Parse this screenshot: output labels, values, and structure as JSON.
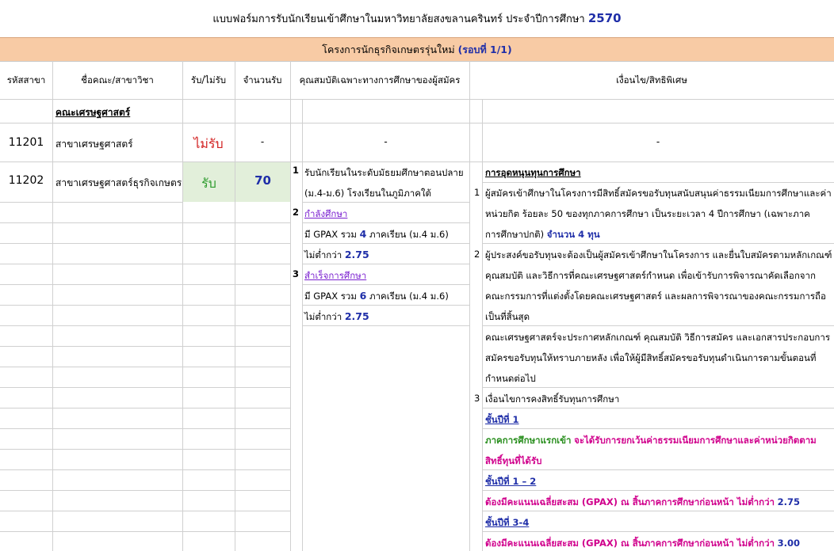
{
  "form_title": "แบบฟอร์มการรับนักเรียนเข้าศึกษาในมหาวิทยาลัยสงขลานครินทร์ ประจำปีการศึกษา",
  "year": "2570",
  "project_name": "โครงการนักธุรกิจเกษตรรุ่นใหม่",
  "round_label": "(รอบที่ 1/1)",
  "headers": {
    "code": "รหัสสาขา",
    "faculty": "ชื่อคณะ/สาขาวิชา",
    "accept": "รับ/ไม่รับ",
    "count": "จำนวนรับ",
    "qualifications": "คุณสมบัติเฉพาะทางการศึกษาของผู้สมัคร",
    "conditions": "เงื่อนไข/สิทธิพิเศษ"
  },
  "faculty_name": "คณะเศรษฐศาสตร์",
  "rows": [
    {
      "code": "11201",
      "major": "สาขาเศรษฐศาสตร์",
      "status": "ไม่รับ",
      "count": "-",
      "qual": "-",
      "cond": "-"
    },
    {
      "code": "11202",
      "major": "สาขาเศรษฐศาสตร์ธุรกิจเกษตร",
      "status": "รับ",
      "count": "70"
    }
  ],
  "qualifications": {
    "n1": "1",
    "q1_line1": "รับนักเรียนในระดับมัธยมศึกษาตอนปลาย",
    "q1_line2": "(ม.4-ม.6) โรงเรียนในภูมิภาคใต้",
    "n2": "2",
    "q2_title": "กำลังศึกษา",
    "q2_line1_pre": "มี GPAX รวม",
    "q2_line1_num": "4",
    "q2_line1_post": "ภาคเรียน (ม.4 ม.6)",
    "q2_line2_pre": "ไม่ต่ำกว่า",
    "q2_line2_num": "2.75",
    "n3": "3",
    "q3_title": "สำเร็จการศึกษา",
    "q3_line1_pre": "มี GPAX รวม",
    "q3_line1_num": "6",
    "q3_line1_post": "ภาคเรียน (ม.4 ม.6)",
    "q3_line2_pre": "ไม่ต่ำกว่า",
    "q3_line2_num": "2.75"
  },
  "conditions": {
    "heading": "การอุดหนุนทุนการศึกษา",
    "n1": "1",
    "c1_line1": "ผู้สมัครเข้าศึกษาในโครงการมีสิทธิ์สมัครขอรับทุนสนับสนุนค่าธรรมเนียมการศึกษาและค่า",
    "c1_line2": "หน่วยกิต ร้อยละ 50 ของทุกภาคการศึกษา เป็นระยะเวลา 4 ปีการศึกษา (เฉพาะภาค",
    "c1_line3_pre": "การศึกษาปกติ)",
    "c1_line3_bold": "จำนวน 4 ทุน",
    "n2": "2",
    "c2_line1": "ผู้ประสงค์ขอรับทุนจะต้องเป็นผู้สมัครเข้าศึกษาในโครงการ และยื่นใบสมัครตามหลักเกณฑ์",
    "c2_line2": "คุณสมบัติ และวิธีการที่คณะเศรษฐศาสตร์กำหนด เพื่อเข้ารับการพิจารณาคัดเลือกจาก",
    "c2_line3": "คณะกรรมการที่แต่งตั้งโดยคณะเศรษฐศาสตร์ และผลการพิจารณาของคณะกรรมการถือ",
    "c2_line4": "เป็นที่สิ้นสุด",
    "c2_line5": "คณะเศรษฐศาสตร์จะประกาศหลักเกณฑ์ คุณสมบัติ วิธีการสมัคร และเอกสารประกอบการ",
    "c2_line6": "สมัครขอรับทุนให้ทราบภายหลัง เพื่อให้ผู้มีสิทธิ์สมัครขอรับทุนดำเนินการตามขั้นตอนที่",
    "c2_line7": "กำหนดต่อไป",
    "n3": "3",
    "c3_line1": "เงื่อนไขการคงสิทธิ์รับทุนการศึกษา",
    "y1_title": "ชั้นปีที่ 1",
    "y1_line1_green": "ภาคการศึกษาแรกเข้า",
    "y1_line1_rest": "จะได้รับการยกเว้นค่าธรรมเนียมการศึกษาและค่าหน่วยกิตตาม",
    "y1_line2": "สิทธิ์ทุนที่ได้รับ",
    "y12_title": "ชั้นปีที่ 1 – 2",
    "y12_line_pre": "ต้องมีคะแนนเฉลี่ยสะสม (GPAX) ณ สิ้นภาคการศึกษาก่อนหน้า ไม่ต่ำกว่า",
    "y12_line_num": "2.75",
    "y34_title": "ชั้นปีที่ 3-4",
    "y34_line_pre": "ต้องมีคะแนนเฉลี่ยสะสม (GPAX) ณ สิ้นภาคการศึกษาก่อนหน้า ไม่ต่ำกว่า",
    "y34_line_num": "3.00"
  }
}
